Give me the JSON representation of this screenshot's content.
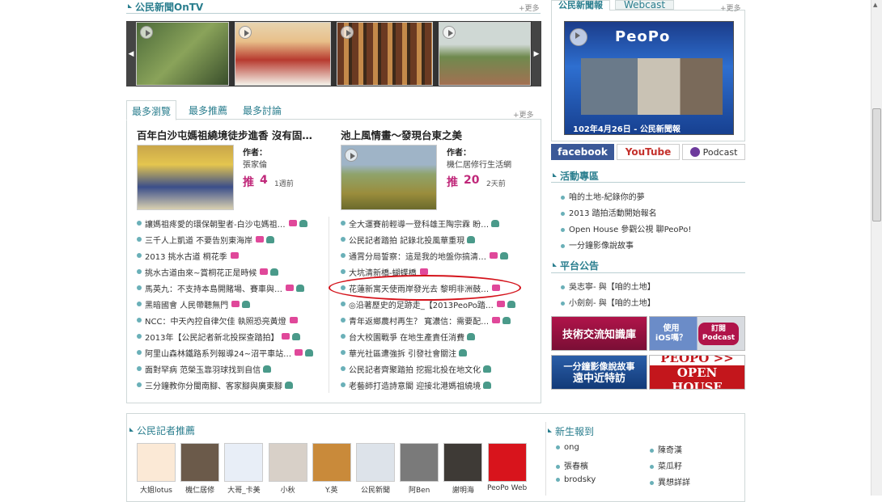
{
  "ontv": {
    "title": "公民新聞OnTV",
    "more": "+更多"
  },
  "webcast": {
    "tab_active": "公民新聞報",
    "tab_other": "Webcast",
    "more": "+更多",
    "logo": "PeoPo",
    "caption": "102年4月26日 - 公民新聞報"
  },
  "social": {
    "facebook": "facebook",
    "youtube": "YouTube",
    "podcast": "Podcast"
  },
  "tabs": {
    "t1": "最多瀏覽",
    "t2": "最多推薦",
    "t3": "最多討論",
    "more": "+更多"
  },
  "feature1": {
    "title": "百年白沙屯媽祖繞境徒步進香 沒有固…",
    "author_label": "作者：",
    "author": "張家倫",
    "push_label": "推",
    "push": "4",
    "ago": "1週前"
  },
  "feature2": {
    "title": "池上風情畫～發現台東之美",
    "author_label": "作者：",
    "author": "機仁居修行生活網",
    "push_label": "推",
    "push": "20",
    "ago": "2天前"
  },
  "left_list": [
    {
      "text": "讓媽祖疼愛的環保朝聖者-白沙屯媽祖…",
      "cam": true,
      "vid": true
    },
    {
      "text": "三千人上凱道 不要告別東海岸",
      "cam": true,
      "vid": true
    },
    {
      "text": "2013 挑水古道 桐花季",
      "cam": true,
      "vid": false
    },
    {
      "text": "挑水古道由來~賞桐花正是時候",
      "cam": true,
      "vid": true
    },
    {
      "text": "馬英九：不支持本島開賭場、賽車與…",
      "cam": true,
      "vid": true
    },
    {
      "text": "黑暗國會 人民帶聽無門",
      "cam": true,
      "vid": true
    },
    {
      "text": "NCC：中天內控自律欠佳 執照恐亮黃燈",
      "cam": true,
      "vid": false
    },
    {
      "text": "2013年【公民記者新北投探查踏拍】",
      "cam": true,
      "vid": true
    },
    {
      "text": "阿里山森林鐵路系列報導24~沼平車站…",
      "cam": true,
      "vid": true
    },
    {
      "text": "面對罕病 范榮玉靠羽球找到自信",
      "cam": false,
      "vid": true
    },
    {
      "text": "三分鐘教你分閩南腳、客家腳與廣東腳",
      "cam": false,
      "vid": true
    }
  ],
  "right_list": [
    {
      "text": "全大運賽前輕導一登科雄王陶宗霖 盼…",
      "cam": false,
      "vid": true
    },
    {
      "text": "公民記者踏拍 記錄北投風華重現",
      "cam": false,
      "vid": true
    },
    {
      "text": "通霄分局誓察：這是我的地盤你搞清…",
      "cam": true,
      "vid": true
    },
    {
      "text": "大坑清新橋-蝴蝶橋",
      "cam": true,
      "vid": false
    },
    {
      "text": "花蓮新寓天使雨岸發光去 黎明非洲鼓…",
      "cam": true,
      "vid": false
    },
    {
      "text": "◎沿著歷史的足跡走_【2013PeoPo踏…",
      "cam": true,
      "vid": true
    },
    {
      "text": "青年返鄉農村再生？ 寬濃信：需要配…",
      "cam": true,
      "vid": true
    },
    {
      "text": "台大校園戰爭 在地生產責任消費",
      "cam": false,
      "vid": true
    },
    {
      "text": "華光社區遭強拆 引發社會關注",
      "cam": false,
      "vid": true
    },
    {
      "text": "公民記者齊聚踏拍 挖掘北投在地文化",
      "cam": false,
      "vid": true
    },
    {
      "text": "老藝師打造詩意閣 迎接北港媽祖繞境",
      "cam": false,
      "vid": true
    }
  ],
  "activity": {
    "title": "活動專區",
    "items": [
      "咱的土地-紀錄你的夢",
      "2013 踏拍活動開始報名",
      "Open House 參觀公視 聊PeoPo!",
      "一分鐘影像說故事"
    ]
  },
  "announce": {
    "title": "平台公告",
    "items": [
      "吳志寧- 與【咱的土地】",
      "小劍劍- 與【咱的土地】"
    ]
  },
  "banners": {
    "b1": "技術交流知識庫",
    "b2a": "使用",
    "b2b": "iOS嗎？",
    "b2c": "訂閱",
    "b2d": "Podcast",
    "b3a": "一分鐘影像說故事",
    "b3b": "遠中近特訪",
    "b4a": "PEOPO >>",
    "b4b": "OPEN HOUSE"
  },
  "recommend": {
    "title": "公民記者推薦",
    "names": [
      "大姐lotus",
      "機仁居修",
      "大哥_卡美",
      "小秋",
      "Y.英",
      "公民新聞",
      "阿Ben",
      "謝明海",
      "PeoPo Web"
    ]
  },
  "newcomer": {
    "title": "新生報到",
    "col1": [
      "ong",
      "張春檳",
      "brodsky"
    ],
    "col2": [
      "陳奇漢",
      "菜瓜籽",
      "異想詳詳"
    ]
  }
}
